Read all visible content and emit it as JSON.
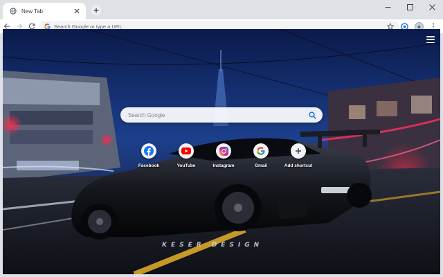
{
  "browser": {
    "tab": {
      "title": "New Tab"
    },
    "toolbar": {
      "omnibox_placeholder": "Search Google or type a URL"
    }
  },
  "newtab": {
    "search_placeholder": "Search Google",
    "shortcuts": [
      {
        "label": "Facebook",
        "icon": "facebook-icon",
        "color": "#1877f2"
      },
      {
        "label": "YouTube",
        "icon": "youtube-icon",
        "color": "#ff0000"
      },
      {
        "label": "Instagram",
        "icon": "instagram-icon",
        "color": "#d62976"
      },
      {
        "label": "Gmail",
        "icon": "google-icon",
        "color": "#4285f4"
      },
      {
        "label": "Add shortcut",
        "icon": "plus-icon",
        "color": "#3c4043"
      }
    ],
    "credit": "KESER DESIGN"
  },
  "colors": {
    "tabstrip": "#dee1e6",
    "accent_blue": "#1a73e8"
  }
}
